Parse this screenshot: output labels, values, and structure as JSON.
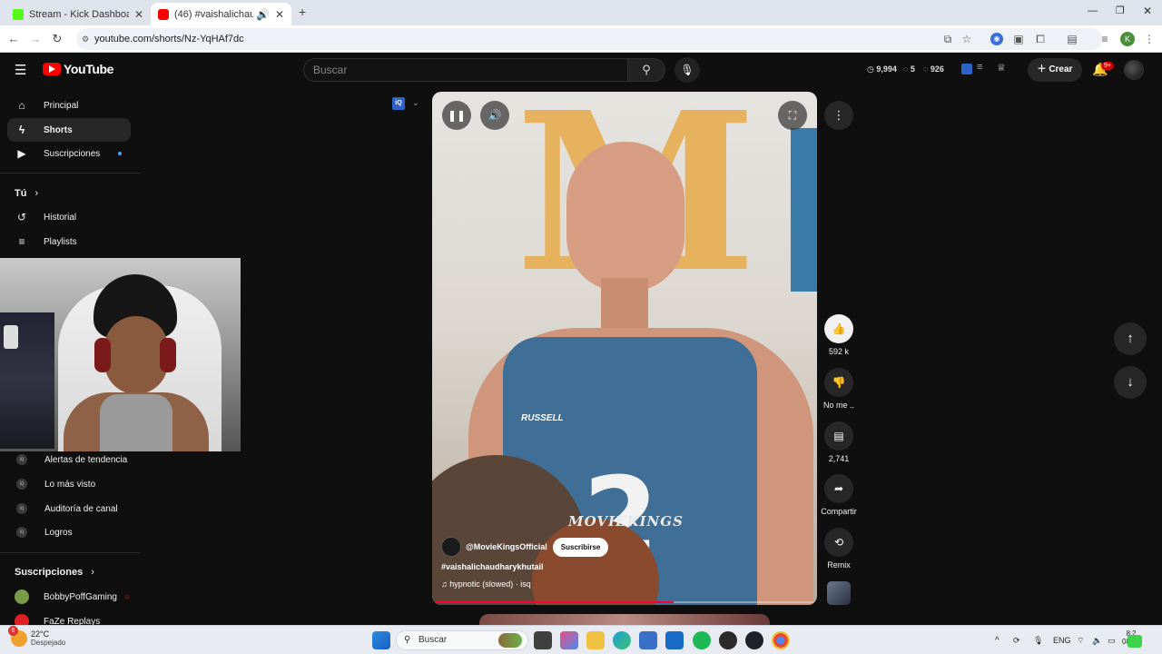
{
  "browser": {
    "tabs": [
      {
        "title": "Stream - Kick Dashboard",
        "favicon_color": "#53fc18"
      },
      {
        "title": "(46) #vaishalichaudharykhu",
        "favicon_color": "#ff0000"
      }
    ],
    "new_tab": "+",
    "url": "youtube.com/shorts/Nz-YqHAf7dc",
    "profile_initial": "K"
  },
  "youtube": {
    "logo_text": "YouTube",
    "search_placeholder": "Buscar",
    "stats": {
      "views": "9,994",
      "a": "5",
      "b": "926"
    },
    "create_label": "Crear",
    "notif_badge": "9+"
  },
  "sidebar": {
    "main": [
      {
        "label": "Principal",
        "icon": "home-icon"
      },
      {
        "label": "Shorts",
        "icon": "shorts-icon"
      },
      {
        "label": "Suscripciones",
        "icon": "subscriptions-icon"
      }
    ],
    "you_title": "Tú",
    "you_items": [
      {
        "label": "Historial",
        "icon": "history-icon"
      },
      {
        "label": "Playlists",
        "icon": "playlists-icon"
      }
    ],
    "iq_items": [
      "Alertas de tendencia",
      "Lo más visto",
      "Auditoría de canal",
      "Logros"
    ],
    "subs_title": "Suscripciones",
    "subscriptions": [
      {
        "label": "BobbyPoffGaming",
        "color": "#7a9a4a"
      },
      {
        "label": "FaZe Replays",
        "color": "#e02020"
      }
    ]
  },
  "short": {
    "iq_badge": "iQ",
    "channel": "@MovieKingsOfficial",
    "subscribe_label": "Suscribirse",
    "title": "#vaishalichaudharykhutail",
    "sound": "hypnotic (slowed) · isq",
    "watermark": "MOVIEKINGS",
    "jersey_brand": "RUSSELL",
    "progress": 0.63
  },
  "actions": {
    "like_count": "592 k",
    "dislike_label": "No me ..",
    "comments_count": "2,741",
    "share_label": "Compartir",
    "remix_label": "Remix"
  },
  "taskbar": {
    "temp": "22°C",
    "weather": "Despejado",
    "weather_badge": "6",
    "search_label": "Buscar",
    "lang": "ENG",
    "time": "8:2",
    "date": "08/2"
  }
}
